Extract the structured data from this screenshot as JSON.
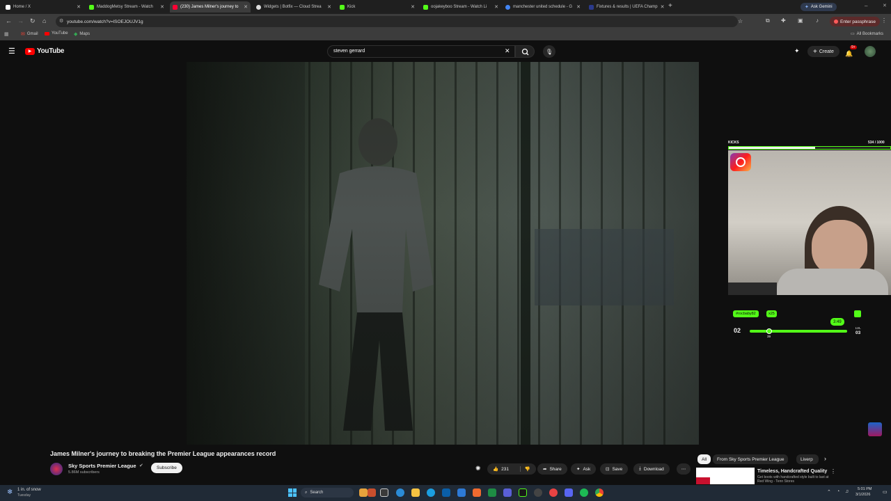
{
  "browser": {
    "tabs": [
      {
        "label": "Home / X",
        "color": "#ffffff",
        "active": false
      },
      {
        "label": "MaddogMetsy Stream - Watch",
        "color": "#53fc18",
        "active": false
      },
      {
        "label": "(230) James Milner's journey to",
        "color": "#ff0033",
        "active": true
      },
      {
        "label": "Widgets | Botfix — Cloud Strea",
        "color": "#dddddd",
        "active": false
      },
      {
        "label": "Kick",
        "color": "#53fc18",
        "active": false
      },
      {
        "label": "oojakeyboo Stream - Watch Li",
        "color": "#53fc18",
        "active": false
      },
      {
        "label": "manchester united schedule - G",
        "color": "#4285f4",
        "active": false
      },
      {
        "label": "Fixtures & results | UEFA Champ",
        "color": "#2b3a8c",
        "active": false
      }
    ],
    "new_tab": "+",
    "ask_gemini": "Ask Gemini",
    "url": "youtube.com/watch?v=lSOEJOUJV1g",
    "passphrase_button": "Enter passphrase",
    "bookmarks": [
      "Gmail",
      "YouTube",
      "Maps"
    ],
    "all_bookmarks": "All Bookmarks"
  },
  "youtube": {
    "logo": "YouTube",
    "search_value": "steven gerrard",
    "create_label": "Create",
    "notification_count": "9+",
    "video_title": "James Milner's journey to breaking the Premier League appearances record",
    "channel_name": "Sky Sports Premier League",
    "subscribers": "5.86M subscribers",
    "subscribe_label": "Subscribe",
    "likes": "231",
    "share_label": "Share",
    "ask_label": "Ask",
    "save_label": "Save",
    "download_label": "Download",
    "chips": [
      "All",
      "From Sky Sports Premier League",
      "Liverp"
    ],
    "rec_title": "Timeless, Handcrafted Quality",
    "rec_desc": "Get boots with handcrafted style built to last at Red Wing - Tenn Stores"
  },
  "overlay": {
    "kicks_label": "KICKS",
    "kicks_count": "534 / 1000",
    "kicks_progress": 0.534,
    "user_tag": "#rocbaby82",
    "multiplier": "x25",
    "timer": "3:49",
    "left_level": "02",
    "right_level": "03",
    "lvl_label": "LVL",
    "slider_value": "39",
    "slider_progress": 0.2
  },
  "taskbar": {
    "weather": "1 in. of snow",
    "weather_sub": "Tuesday",
    "search_label": "Search",
    "time": "5:01 PM",
    "date": "3/1/2026"
  },
  "colors": {
    "youtube_red": "#ff0000",
    "kick_green": "#53fc18",
    "bg": "#0f0f0f"
  }
}
